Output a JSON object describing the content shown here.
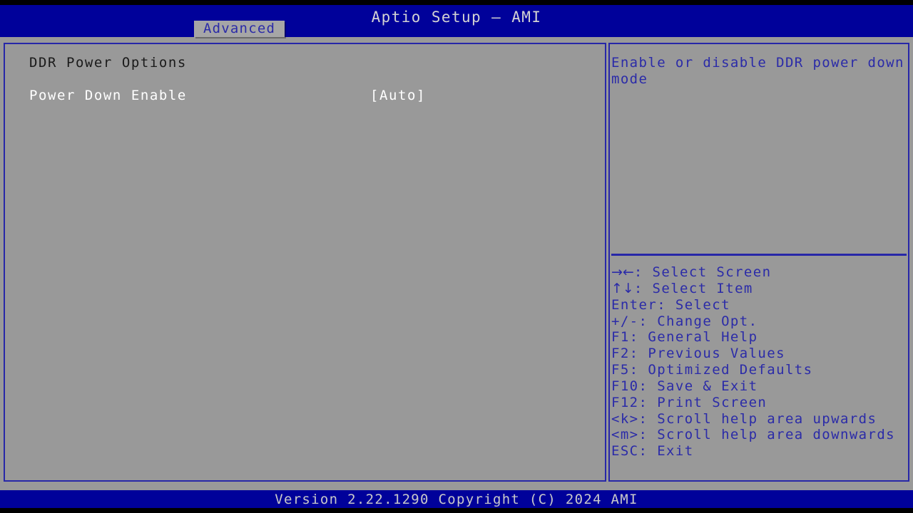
{
  "app": {
    "title": "Aptio Setup – AMI",
    "colors": {
      "header_blue": "#00019a",
      "panel_gray": "#999999",
      "border_blue": "#2727a8",
      "help_text_blue": "#2b2ba8",
      "item_white": "#ffffff",
      "heading_black": "#1a1a1a",
      "letterbox_black": "#000000"
    }
  },
  "tabs": [
    {
      "label": "Advanced",
      "active": true
    }
  ],
  "main": {
    "section_heading": "DDR Power Options",
    "options": [
      {
        "label": "Power Down Enable",
        "value": "[Auto]",
        "selected": false
      }
    ]
  },
  "help": {
    "text": "Enable or disable DDR power down mode",
    "keys": [
      {
        "glyph": "→←",
        "key_suffix": ": ",
        "action": "Select Screen"
      },
      {
        "glyph": "↑↓",
        "key_suffix": ": ",
        "action": "Select Item"
      },
      {
        "glyph": "",
        "key_suffix": "Enter: ",
        "action": "Select"
      },
      {
        "glyph": "",
        "key_suffix": "+/-: ",
        "action": "Change Opt."
      },
      {
        "glyph": "",
        "key_suffix": "F1: ",
        "action": "General Help"
      },
      {
        "glyph": "",
        "key_suffix": "F2: ",
        "action": "Previous Values"
      },
      {
        "glyph": "",
        "key_suffix": "F5: ",
        "action": "Optimized Defaults"
      },
      {
        "glyph": "",
        "key_suffix": "F10: ",
        "action": "Save & Exit"
      },
      {
        "glyph": "",
        "key_suffix": "F12: ",
        "action": "Print Screen"
      },
      {
        "glyph": "",
        "key_suffix": "<k>: ",
        "action": "Scroll help area upwards"
      },
      {
        "glyph": "",
        "key_suffix": "<m>: ",
        "action": "Scroll help area downwards"
      },
      {
        "glyph": "",
        "key_suffix": "ESC: ",
        "action": "Exit"
      }
    ]
  },
  "footer": {
    "version_text": "Version 2.22.1290 Copyright (C) 2024 AMI"
  }
}
